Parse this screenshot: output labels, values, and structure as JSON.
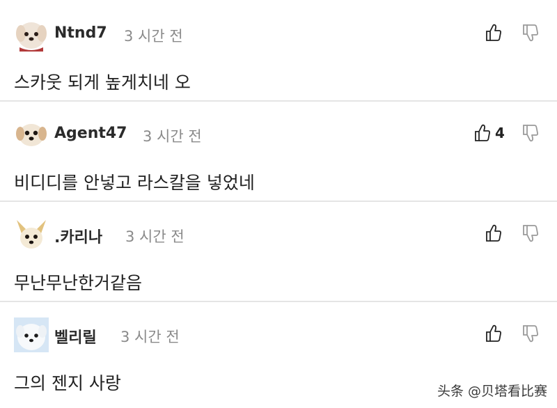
{
  "comments": [
    {
      "avatar": "maltese-dog-avatar",
      "username": "Ntnd7",
      "time": "3 시간 전",
      "text": "스카웃 되게 높게치네 오",
      "likes": ""
    },
    {
      "avatar": "puppy-avatar",
      "username": "Agent47",
      "time": "3 시간 전",
      "text": "비디디를 안넣고 라스칼을 넣었네",
      "likes": "4"
    },
    {
      "avatar": "chihuahua-avatar",
      "username": ".카리나",
      "time": "3 시간 전",
      "text": "무난무난한거같음",
      "likes": ""
    },
    {
      "avatar": "white-dog-avatar",
      "username": "벨리릴",
      "time": "3 시간 전",
      "text": "그의 젠지 사랑",
      "likes": ""
    }
  ],
  "icons": {
    "like": "thumbs-up-icon",
    "dislike": "thumbs-down-icon"
  },
  "watermark": "头条 @贝塔看比赛",
  "colors": {
    "divider": "#e5e5e5",
    "username": "#2b2b2b",
    "timestamp": "#8a8a8a",
    "text": "#1f1f1f"
  }
}
